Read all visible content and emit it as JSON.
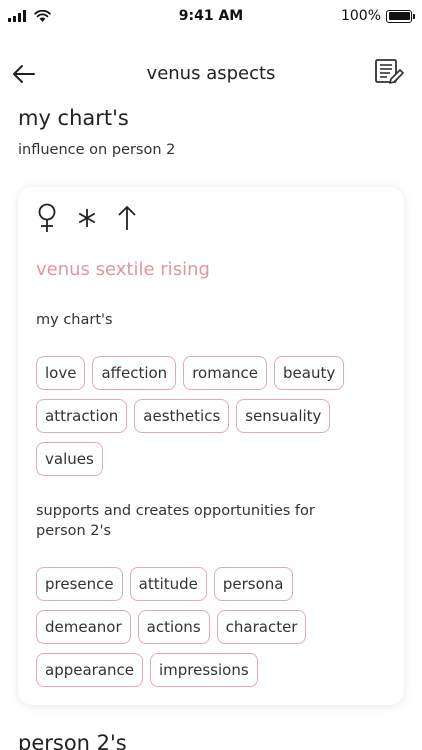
{
  "status_bar": {
    "time": "9:41 AM",
    "battery": "100%",
    "battery_level": 1.0
  },
  "nav": {
    "title": "venus aspects",
    "back_icon": "arrow-left-icon",
    "notes_icon": "notes-edit-icon"
  },
  "section": {
    "title": "my chart's",
    "subtitle": "influence on person 2"
  },
  "card": {
    "glyphs": [
      "venus-glyph-icon",
      "sextile-glyph-icon",
      "rising-arrow-icon"
    ],
    "aspect_title": "venus sextile rising",
    "planet_label": "my chart's",
    "planet_tags": [
      "love",
      "affection",
      "romance",
      "beauty",
      "attraction",
      "aesthetics",
      "sensuality",
      "values"
    ],
    "support_label": "supports and creates opportunities for person 2's",
    "target_tags": [
      "presence",
      "attitude",
      "persona",
      "demeanor",
      "actions",
      "character",
      "appearance",
      "impressions"
    ]
  },
  "next_section": {
    "title": "person 2's"
  },
  "colors": {
    "accent": "#e3959d",
    "tag_border": "#e6a9b0"
  }
}
